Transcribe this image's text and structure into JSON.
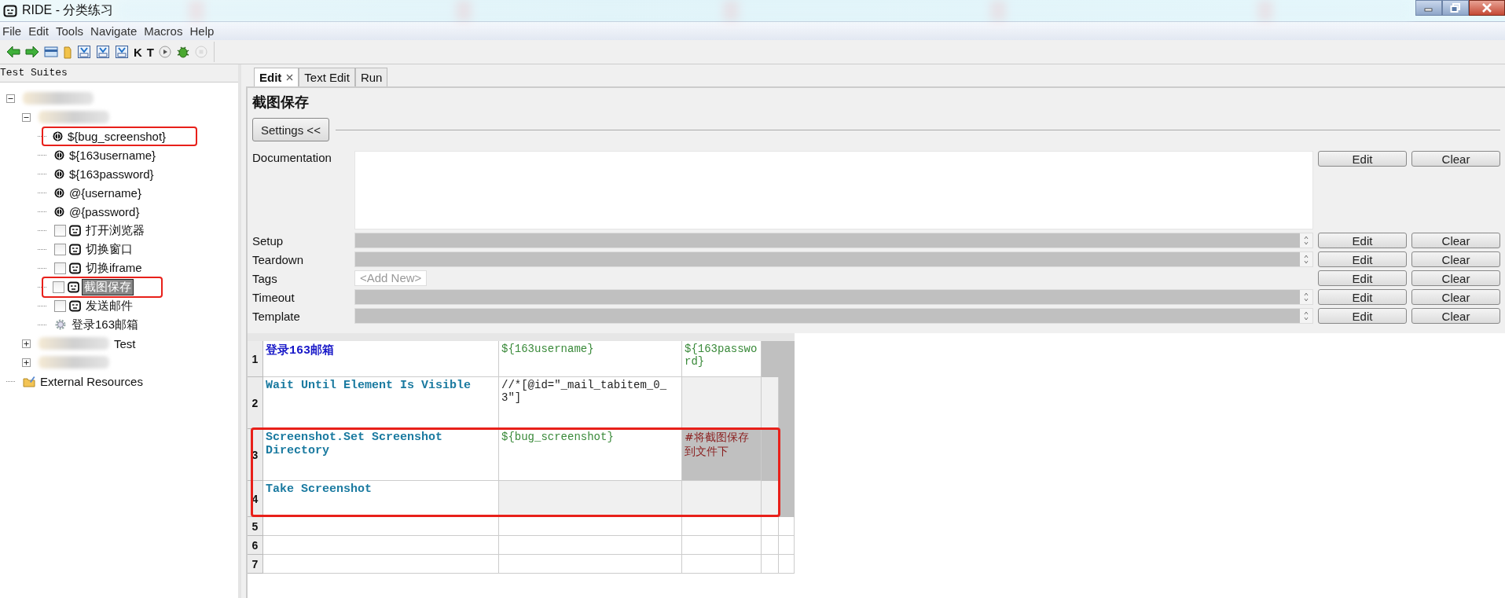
{
  "window": {
    "title": "RIDE - 分类练习"
  },
  "menu": [
    "File",
    "Edit",
    "Tools",
    "Navigate",
    "Macros",
    "Help"
  ],
  "toolbar": [
    {
      "kind": "back"
    },
    {
      "kind": "forward"
    },
    {
      "kind": "open"
    },
    {
      "kind": "folder"
    },
    {
      "kind": "save"
    },
    {
      "kind": "save-as"
    },
    {
      "kind": "save-all"
    },
    {
      "kind": "letter",
      "label": "K"
    },
    {
      "kind": "letter",
      "label": "T"
    },
    {
      "kind": "play"
    },
    {
      "kind": "bug"
    },
    {
      "kind": "stop"
    }
  ],
  "tree": {
    "title": "Test Suites",
    "items": [
      {
        "kind": "blurred",
        "expanded": true,
        "children": [
          {
            "kind": "blurred",
            "expanded": true,
            "children": [
              {
                "kind": "variable",
                "label": "${bug_screenshot}",
                "selected": false,
                "highlighted": true
              },
              {
                "kind": "variable",
                "label": "${163username}",
                "selected": false,
                "highlighted": false
              },
              {
                "kind": "variable",
                "label": "${163password}",
                "selected": false,
                "highlighted": false
              },
              {
                "kind": "variable",
                "label": "@{username}",
                "selected": false,
                "highlighted": false
              },
              {
                "kind": "variable",
                "label": "@{password}",
                "selected": false,
                "highlighted": false
              },
              {
                "kind": "test",
                "label": "打开浏览器",
                "checked": false,
                "selected": false,
                "highlighted": false
              },
              {
                "kind": "test",
                "label": "切换窗口",
                "checked": false,
                "selected": false,
                "highlighted": false
              },
              {
                "kind": "test",
                "label": "切换iframe",
                "checked": false,
                "selected": false,
                "highlighted": false
              },
              {
                "kind": "test",
                "label": "截图保存",
                "checked": false,
                "selected": true,
                "highlighted": true
              },
              {
                "kind": "test",
                "label": "发送邮件",
                "checked": false,
                "selected": false,
                "highlighted": false
              },
              {
                "kind": "keyword",
                "label": "登录163邮箱",
                "selected": false,
                "highlighted": false
              }
            ]
          },
          {
            "kind": "blurred",
            "label": "Test",
            "expanded": false
          },
          {
            "kind": "blurred",
            "expanded": false
          }
        ]
      },
      {
        "kind": "resources",
        "label": "External Resources"
      }
    ]
  },
  "tabs": [
    {
      "label": "Edit",
      "selected": true
    },
    {
      "label": "Text Edit",
      "selected": false
    },
    {
      "label": "Run",
      "selected": false
    }
  ],
  "editor": {
    "title": "截图保存",
    "settings_button": "Settings <<",
    "settings": [
      {
        "label": "Documentation",
        "kind": "doc",
        "buttons": [
          "Edit",
          "Clear"
        ]
      },
      {
        "label": "Setup",
        "kind": "field",
        "buttons": [
          "Edit",
          "Clear"
        ]
      },
      {
        "label": "Teardown",
        "kind": "field",
        "buttons": [
          "Edit",
          "Clear"
        ]
      },
      {
        "label": "Tags",
        "kind": "tags",
        "placeholder": "<Add New>",
        "buttons": [
          "Edit",
          "Clear"
        ]
      },
      {
        "label": "Timeout",
        "kind": "field",
        "buttons": [
          "Edit",
          "Clear"
        ]
      },
      {
        "label": "Template",
        "kind": "field",
        "buttons": [
          "Edit",
          "Clear"
        ]
      }
    ]
  },
  "table": {
    "rows": [
      {
        "number": "1",
        "highlighted": false,
        "cells": [
          {
            "kind": "user_keyword",
            "text": "登录163邮箱"
          },
          {
            "kind": "argument",
            "text": "${163username}"
          },
          {
            "kind": "argument",
            "text": "${163password}"
          },
          {
            "kind": "filler"
          },
          {
            "kind": "filler"
          }
        ]
      },
      {
        "number": "2",
        "highlighted": false,
        "cells": [
          {
            "kind": "keyword",
            "text": "Wait Until Element Is Visible"
          },
          {
            "kind": "string",
            "text": "//*[@id=″_mail_tabitem_0_3″]"
          },
          {
            "kind": "unused"
          },
          {
            "kind": "unused"
          },
          {
            "kind": "filler"
          }
        ]
      },
      {
        "number": "3",
        "highlighted": true,
        "cells": [
          {
            "kind": "keyword",
            "text": "Screenshot.Set Screenshot Directory"
          },
          {
            "kind": "argument",
            "text": "${bug_screenshot}"
          },
          {
            "kind": "comment",
            "text": "#将截图保存到文件下"
          },
          {
            "kind": "filler"
          },
          {
            "kind": "filler"
          }
        ]
      },
      {
        "number": "4",
        "highlighted": true,
        "cells": [
          {
            "kind": "keyword",
            "text": "Take Screenshot"
          },
          {
            "kind": "unused"
          },
          {
            "kind": "unused"
          },
          {
            "kind": "unused"
          },
          {
            "kind": "filler"
          }
        ]
      },
      {
        "number": "5",
        "highlighted": false,
        "cells": [
          {
            "kind": "blank"
          },
          {
            "kind": "blank"
          },
          {
            "kind": "blank"
          },
          {
            "kind": "blank"
          },
          {
            "kind": "blank"
          }
        ]
      },
      {
        "number": "6",
        "highlighted": false,
        "cells": [
          {
            "kind": "blank"
          },
          {
            "kind": "blank"
          },
          {
            "kind": "blank"
          },
          {
            "kind": "blank"
          },
          {
            "kind": "blank"
          }
        ]
      },
      {
        "number": "7",
        "highlighted": false,
        "cells": [
          {
            "kind": "blank"
          },
          {
            "kind": "blank"
          },
          {
            "kind": "blank"
          },
          {
            "kind": "blank"
          },
          {
            "kind": "blank"
          }
        ]
      }
    ]
  }
}
